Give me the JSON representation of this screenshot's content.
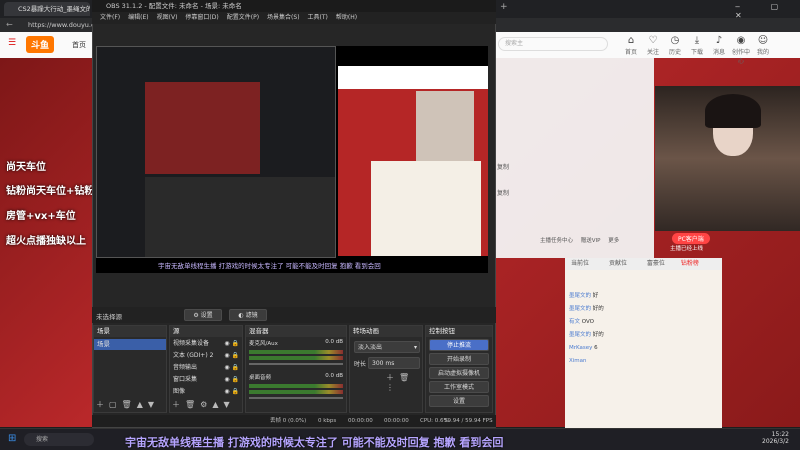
{
  "browser": {
    "tabs": [
      "CS2暴躁大行动_墨绳文的...",
      "OBS 31.1.2"
    ],
    "url": "https://www.douyu.com"
  },
  "site": {
    "logo": "斗鱼",
    "nav_first": "首页",
    "search_placeholder": "搜索主",
    "header_icons": [
      {
        "label": "首页",
        "icon": "home-icon"
      },
      {
        "label": "关注",
        "icon": "heart-icon"
      },
      {
        "label": "历史",
        "icon": "clock-icon"
      },
      {
        "label": "下载",
        "icon": "download-icon"
      },
      {
        "label": "消息",
        "icon": "bell-icon"
      },
      {
        "label": "创作中心",
        "icon": "camera-icon"
      },
      {
        "label": "我的",
        "icon": "user-icon"
      }
    ],
    "promo": [
      "尚天车位",
      "钻粉尚天车位+钻粉群",
      "房管+vx+车位",
      "超火点播独缺以上"
    ],
    "side_labels": [
      "复制",
      "复制"
    ],
    "bottom_icons": [
      "主播任务中心",
      "赠送VIP",
      "更多"
    ],
    "rank_tabs": [
      "当前位",
      "贡献位",
      "富豪位",
      "钻粉榜"
    ],
    "pc_badge": "PC客户端",
    "cam_label": "主播已经上线",
    "chat": [
      {
        "user": "墨尾文的",
        "text": "好"
      },
      {
        "user": "墨尾文的",
        "text": "好的"
      },
      {
        "user": "有文",
        "text": "OVO"
      },
      {
        "user": "墨尾文的",
        "text": "好的"
      },
      {
        "user": "MrKasey",
        "text": "6"
      },
      {
        "user": "Ximan",
        "text": ""
      }
    ]
  },
  "obs": {
    "title": "OBS 31.1.2 - 配置文件: 未命名 - 场景: 未命名",
    "menu": [
      "文件(F)",
      "编辑(E)",
      "视图(V)",
      "停靠窗口(D)",
      "配置文件(P)",
      "场景集合(S)",
      "工具(T)",
      "帮助(H)"
    ],
    "no_source": "未选择源",
    "props_label": "设置",
    "filters_label": "滤镜",
    "docks": {
      "scenes": {
        "title": "场景",
        "items": [
          "场景"
        ]
      },
      "sources": {
        "title": "源",
        "items": [
          "视频采集设备",
          "文本 (GDI+) 2",
          "音频输出",
          "窗口采集",
          "图像"
        ]
      },
      "mixer": {
        "title": "混音器",
        "tracks": [
          {
            "name": "麦克风/Aux",
            "db": "0.0 dB"
          },
          {
            "name": "桌面音频",
            "db": "0.0 dB"
          }
        ]
      },
      "transitions": {
        "title": "转场动画",
        "type": "淡入淡出",
        "duration_label": "时长",
        "duration": "300 ms"
      },
      "controls": {
        "title": "控制按钮",
        "buttons": [
          "停止推流",
          "开始录制",
          "启动虚拟摄像机",
          "工作室模式",
          "设置"
        ]
      }
    },
    "status": {
      "dropped": "丢帧 0 (0.0%)",
      "bitrate": "0 kbps",
      "stream_time": "00:00:00",
      "rec_time": "00:00:00",
      "cpu": "CPU: 0.6%",
      "fps": "59.94 / 59.94 FPS"
    }
  },
  "taskbar": {
    "search": "搜索",
    "time": "15:22",
    "date": "2026/3/2"
  },
  "subtitle": "宇宙无敌单线程生播 打游戏的时候太专注了 可能不能及时回复 抱歉 看到会回"
}
